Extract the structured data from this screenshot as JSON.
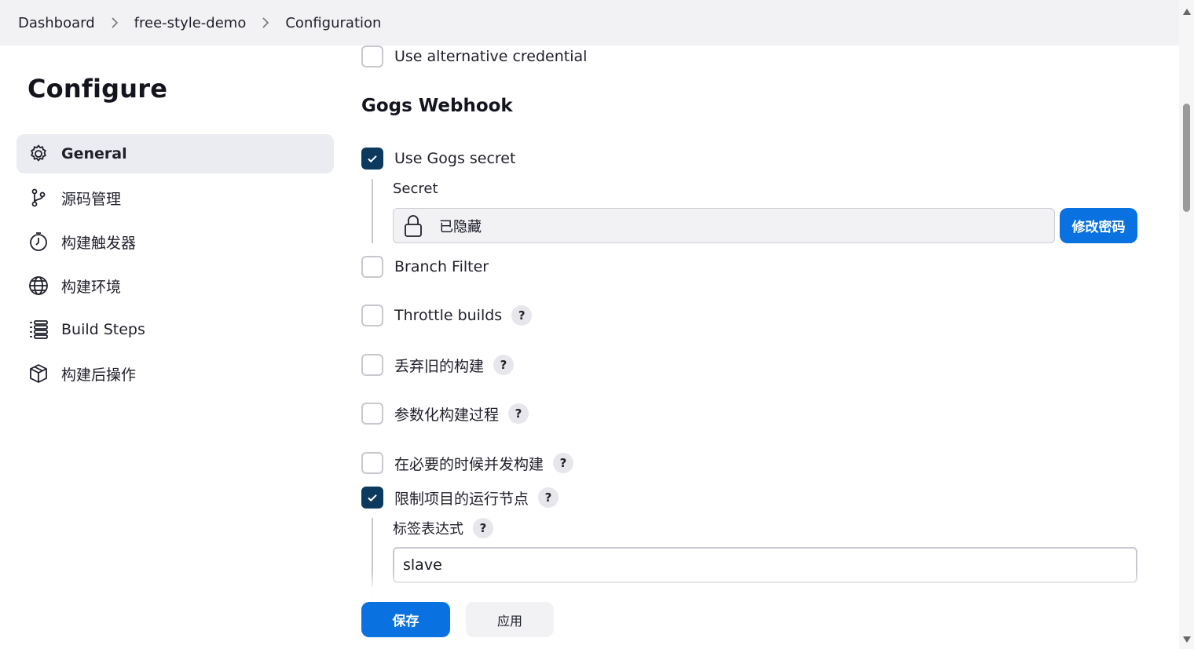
{
  "breadcrumb": {
    "items": [
      "Dashboard",
      "free-style-demo",
      "Configuration"
    ]
  },
  "sidebar": {
    "title": "Configure",
    "items": [
      {
        "label": "General",
        "icon": "gear-icon",
        "active": true
      },
      {
        "label": "源码管理",
        "icon": "branch-icon",
        "active": false
      },
      {
        "label": "构建触发器",
        "icon": "clock-icon",
        "active": false
      },
      {
        "label": "构建环境",
        "icon": "globe-icon",
        "active": false
      },
      {
        "label": "Build Steps",
        "icon": "list-icon",
        "active": false
      },
      {
        "label": "构建后操作",
        "icon": "package-icon",
        "active": false
      }
    ]
  },
  "main": {
    "alt_credential_label": "Use alternative credential",
    "gogs_section_title": "Gogs Webhook",
    "use_gogs_secret_label": "Use Gogs secret",
    "secret_label": "Secret",
    "secret_value": "已隐藏",
    "change_password_label": "修改密码",
    "branch_filter_label": "Branch Filter",
    "throttle_builds_label": "Throttle builds",
    "discard_old_builds_label": "丢弃旧的构建",
    "parameterized_label": "参数化构建过程",
    "concurrent_builds_label": "在必要的时候并发构建",
    "restrict_node_label": "限制项目的运行节点",
    "label_expression_label": "标签表达式",
    "label_expression_value": "slave",
    "help_glyph": "?"
  },
  "footer": {
    "save_label": "保存",
    "apply_label": "应用"
  },
  "colors": {
    "primary": "#0a72e0",
    "checkbox_checked": "#0b3a5e",
    "breadcrumb_bg": "#f2f2f5",
    "active_nav_bg": "#ebebf2"
  }
}
